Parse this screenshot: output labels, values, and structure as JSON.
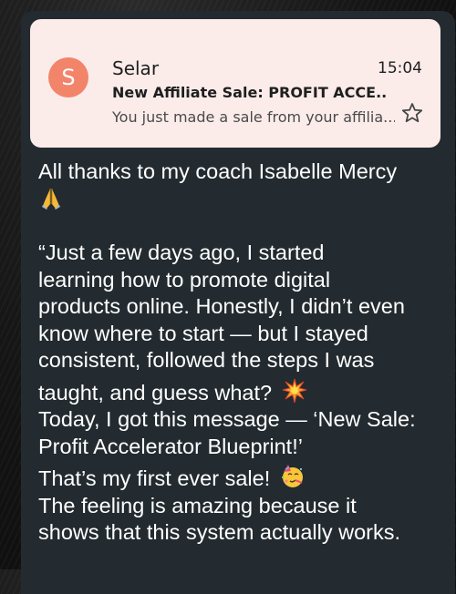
{
  "notification": {
    "avatar_letter": "S",
    "sender": "Selar",
    "time": "15:04",
    "subject": "New Affiliate Sale: PROFIT ACCE...",
    "preview": "You just made a sale from your affilia...",
    "icon": "star-outline-icon",
    "avatar_color": "#f2846a",
    "card_color": "#fbecea"
  },
  "message": {
    "line1": "All thanks to my coach Isabelle Mercy",
    "line1_emoji": "praying-hands-emoji",
    "para1_l1": "“Just a few days ago, I started",
    "para1_l2": "learning how to promote digital",
    "para1_l3": "products online. Honestly, I didn’t even",
    "para1_l4": "know where to start — but I stayed",
    "para1_l5": "consistent, followed the steps I was",
    "para1_l6": "taught, and guess what?",
    "para1_emoji": "collision-emoji",
    "para2_l1": "Today, I got this message — ‘New Sale:",
    "para2_l2": "Profit Accelerator Blueprint!’",
    "para3": "That’s my first ever sale!",
    "para3_emoji": "partying-face-emoji",
    "para4_l1": "The feeling is amazing because it",
    "para4_l2": "shows that this system actually works.",
    "bubble_color": "#232b30"
  }
}
